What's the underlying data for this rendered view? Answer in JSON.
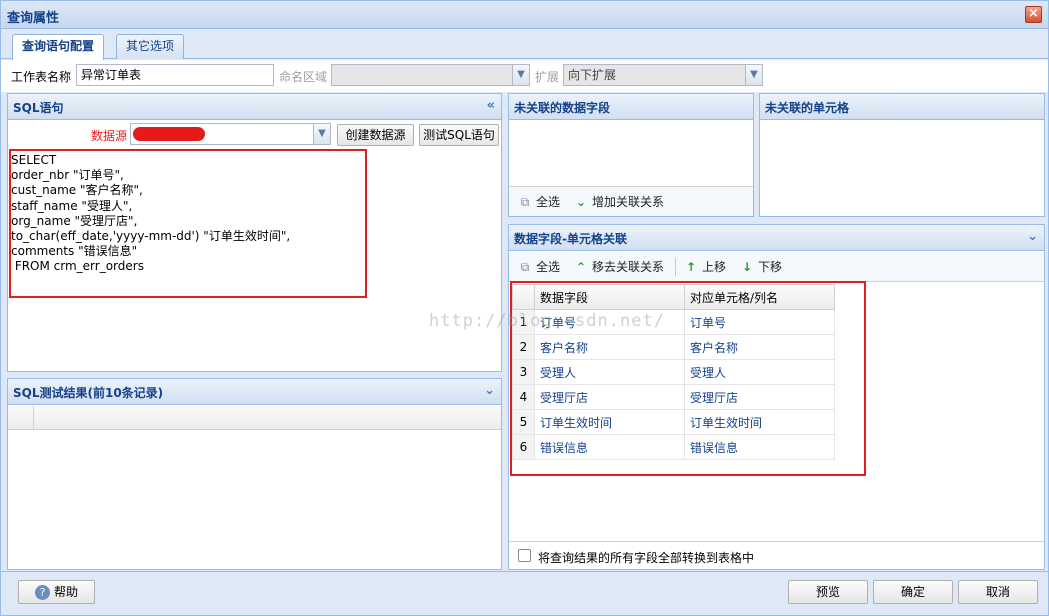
{
  "window": {
    "title": "查询属性"
  },
  "tabs": [
    {
      "label": "查询语句配置"
    },
    {
      "label": "其它选项"
    }
  ],
  "form": {
    "sheet_name_label": "工作表名称",
    "sheet_name_value": "异常订单表",
    "named_region_label": "命名区域",
    "named_region_value": "",
    "extend_label": "扩展",
    "extend_value": "向下扩展"
  },
  "sql_panel": {
    "title": "SQL语句",
    "datasource_label": "数据源",
    "create_datasource_btn": "创建数据源",
    "test_sql_btn": "测试SQL语句",
    "sql_lines": [
      "SELECT",
      "order_nbr \"订单号\",",
      "cust_name \"客户名称\",",
      "staff_name \"受理人\",",
      "org_name \"受理厅店\",",
      "to_char(eff_date,'yyyy-mm-dd') \"订单生效时间\",",
      "comments \"错误信息\"",
      " FROM crm_err_orders"
    ]
  },
  "sql_test_panel": {
    "title": "SQL测试结果(前10条记录)"
  },
  "unlinked_fields_panel": {
    "title": "未关联的数据字段",
    "select_all": "全选",
    "add_link": "增加关联关系"
  },
  "unlinked_cells_panel": {
    "title": "未关联的单元格"
  },
  "mapping_panel": {
    "title": "数据字段-单元格关联",
    "select_all": "全选",
    "remove_link": "移去关联关系",
    "move_up": "上移",
    "move_down": "下移",
    "columns": [
      "数据字段",
      "对应单元格/列名"
    ],
    "rows": [
      {
        "n": "1",
        "field": "订单号",
        "cell": "订单号"
      },
      {
        "n": "2",
        "field": "客户名称",
        "cell": "客户名称"
      },
      {
        "n": "3",
        "field": "受理人",
        "cell": "受理人"
      },
      {
        "n": "4",
        "field": "受理厅店",
        "cell": "受理厅店"
      },
      {
        "n": "5",
        "field": "订单生效时间",
        "cell": "订单生效时间"
      },
      {
        "n": "6",
        "field": "错误信息",
        "cell": "错误信息"
      }
    ],
    "convert_all_label": "将查询结果的所有字段全部转换到表格中"
  },
  "watermark": "http://blog.csdn.net/",
  "footer": {
    "help": "帮助",
    "preview": "预览",
    "ok": "确定",
    "cancel": "取消"
  }
}
